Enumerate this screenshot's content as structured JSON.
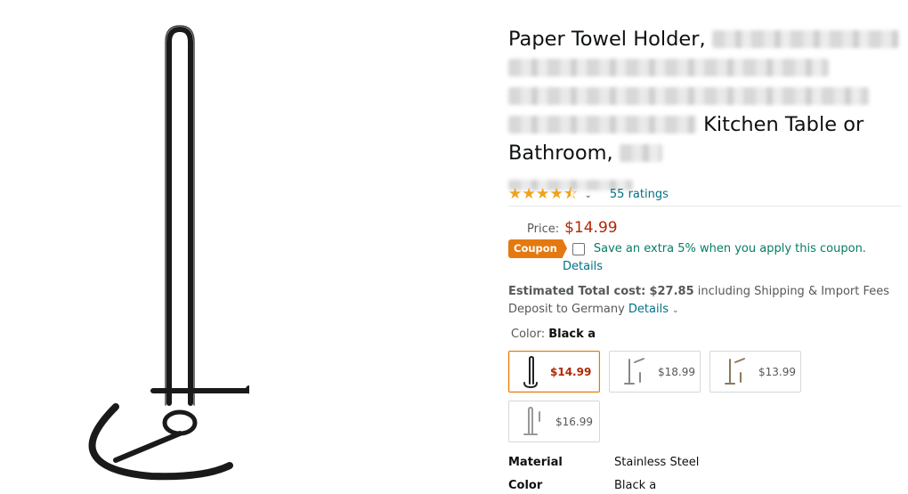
{
  "product": {
    "title_start": "Paper Towel Holder,",
    "title_mid": "Kitchen Table or",
    "title_end": "Bathroom,",
    "rating_stars": 4.5,
    "ratings_text": "55 ratings"
  },
  "price": {
    "label": "Price:",
    "value": "$14.99"
  },
  "coupon": {
    "badge": "Coupon",
    "text": "Save an extra 5% when you apply this coupon.",
    "details": "Details"
  },
  "estimate": {
    "label": "Estimated Total cost:",
    "amount": "$27.85",
    "suffix": "including Shipping & Import Fees",
    "line2": "Deposit to Germany",
    "details": "Details"
  },
  "color": {
    "label": "Color:",
    "value": "Black a"
  },
  "swatches": [
    {
      "price": "$14.99",
      "selected": true
    },
    {
      "price": "$18.99",
      "selected": false
    },
    {
      "price": "$13.99",
      "selected": false
    },
    {
      "price": "$16.99",
      "selected": false
    }
  ],
  "specs": [
    {
      "key": "Material",
      "value": "Stainless Steel"
    },
    {
      "key": "Color",
      "value": "Black a"
    }
  ],
  "colors": {
    "link": "#007185",
    "price": "#b12704",
    "coupon": "#e47911",
    "coupon_text": "#067d62",
    "star": "#f0a21e"
  }
}
